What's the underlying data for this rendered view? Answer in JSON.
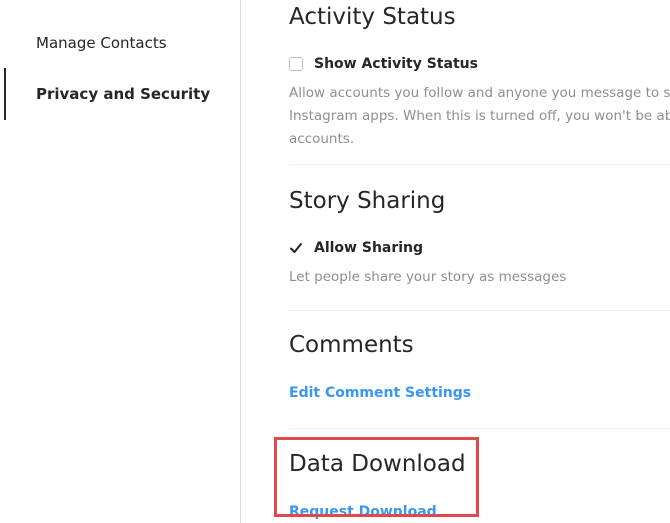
{
  "sidebar": {
    "items": [
      {
        "label": "Manage Contacts"
      },
      {
        "label": "Privacy and Security"
      }
    ]
  },
  "activity_status": {
    "title": "Activity Status",
    "checkbox_label": "Show Activity Status",
    "checked": false,
    "help_lines": [
      "Allow accounts you follow and anyone you message to see wh",
      "Instagram apps. When this is turned off, you won't be able to",
      "accounts."
    ]
  },
  "story_sharing": {
    "title": "Story Sharing",
    "checkbox_label": "Allow Sharing",
    "checked": true,
    "help_text": "Let people share your story as messages"
  },
  "comments": {
    "title": "Comments",
    "link_label": "Edit Comment Settings"
  },
  "data_download": {
    "title": "Data Download",
    "link_label": "Request Download"
  },
  "colors": {
    "link": "#3897f0",
    "highlight": "#e0484e",
    "help_text": "#8e8e8e"
  }
}
